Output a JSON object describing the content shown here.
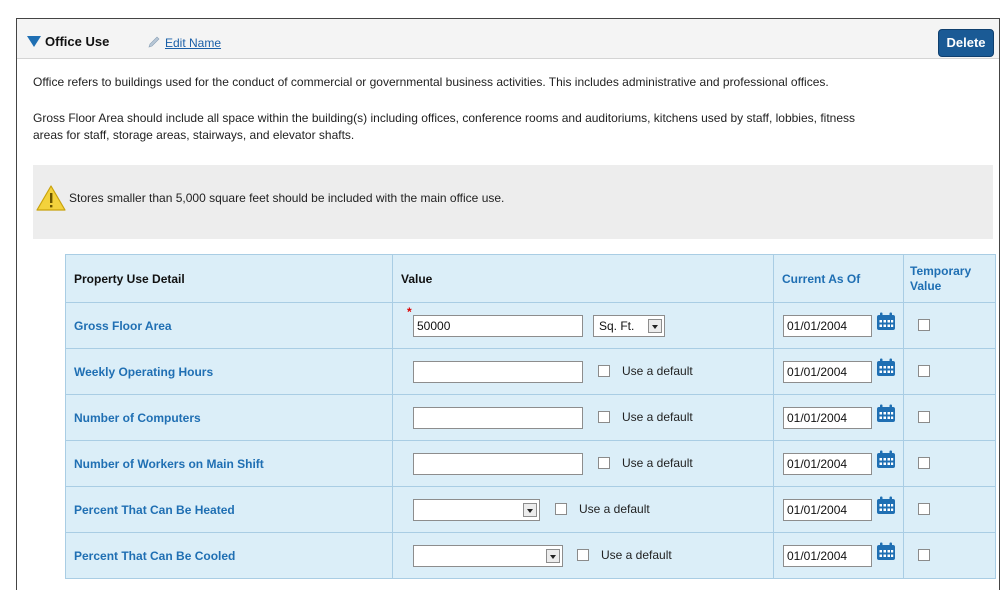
{
  "header": {
    "title": "Office Use",
    "edit_name_label": "Edit Name",
    "delete_label": "Delete"
  },
  "descriptions": [
    "Office refers to buildings used for the conduct of commercial or governmental business activities. This includes administrative and professional offices.",
    "Gross Floor Area should include all space within the building(s) including offices, conference rooms and auditoriums, kitchens used by staff, lobbies, fitness",
    "areas for staff, storage areas, stairways, and elevator shafts."
  ],
  "warning": {
    "text": "Stores smaller than 5,000 square feet should be included with the main office use."
  },
  "table": {
    "headers": {
      "detail": "Property Use Detail",
      "value": "Value",
      "current_as_of": "Current As Of",
      "temporary_line1": "Temporary",
      "temporary_line2": "Value"
    },
    "use_default_label": "Use a default",
    "rows": [
      {
        "label": "Gross Floor Area",
        "value": "50000",
        "unit": "Sq. Ft.",
        "date": "01/01/2004",
        "required": "*"
      },
      {
        "label": "Weekly Operating Hours",
        "value": "",
        "date": "01/01/2004"
      },
      {
        "label": "Number of Computers",
        "value": "",
        "date": "01/01/2004"
      },
      {
        "label": "Number of Workers on Main Shift",
        "value": "",
        "date": "01/01/2004"
      },
      {
        "label": "Percent That Can Be Heated",
        "value": "",
        "date": "01/01/2004"
      },
      {
        "label": "Percent That Can Be Cooled",
        "value": "",
        "date": "01/01/2004"
      }
    ]
  },
  "colors": {
    "accent": "#1f6fb3",
    "table_bg": "#dbeef8",
    "delete_bg": "#1a5a95",
    "warning_bg": "#ededed"
  },
  "icons": [
    "collapse-triangle-icon",
    "pencil-icon",
    "warning-icon",
    "calendar-icon"
  ]
}
